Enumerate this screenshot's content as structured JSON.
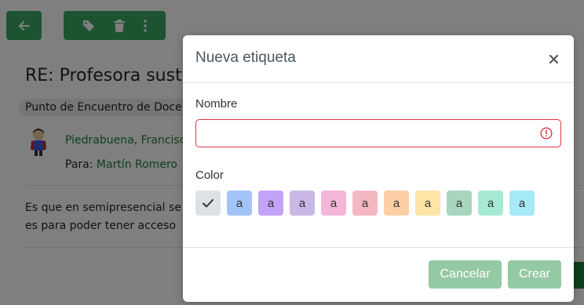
{
  "background": {
    "subject": "RE: Profesora sustituta",
    "chip": "Punto de Encuentro de Docentes",
    "sender": "Piedrabuena, Francisco",
    "to_prefix": "Para: ",
    "to_name": "Martín Romero",
    "body_line1": "Es que en semipresencial se hace así",
    "body_line2": "es para poder tener acceso"
  },
  "modal": {
    "title": "Nueva etiqueta",
    "close_symbol": "×",
    "name_label": "Nombre",
    "name_value": "",
    "color_label": "Color",
    "swatches": [
      {
        "letter": "",
        "color": "#dee2e6",
        "selected": true
      },
      {
        "letter": "a",
        "color": "#a3c4f7"
      },
      {
        "letter": "a",
        "color": "#c3a3f7"
      },
      {
        "letter": "a",
        "color": "#c9b8e6"
      },
      {
        "letter": "a",
        "color": "#f3b6d9"
      },
      {
        "letter": "a",
        "color": "#f4b8c1"
      },
      {
        "letter": "a",
        "color": "#fdcfa6"
      },
      {
        "letter": "a",
        "color": "#fde5a6"
      },
      {
        "letter": "a",
        "color": "#a8d5be"
      },
      {
        "letter": "a",
        "color": "#a6ead4"
      },
      {
        "letter": "a",
        "color": "#a6e9f7"
      }
    ],
    "cancel_label": "Cancelar",
    "create_label": "Crear"
  },
  "colors": {
    "accent": "#3ba663",
    "link": "#1e7e34",
    "invalid": "#dc3545",
    "button_disabled": "#94c9a4"
  }
}
